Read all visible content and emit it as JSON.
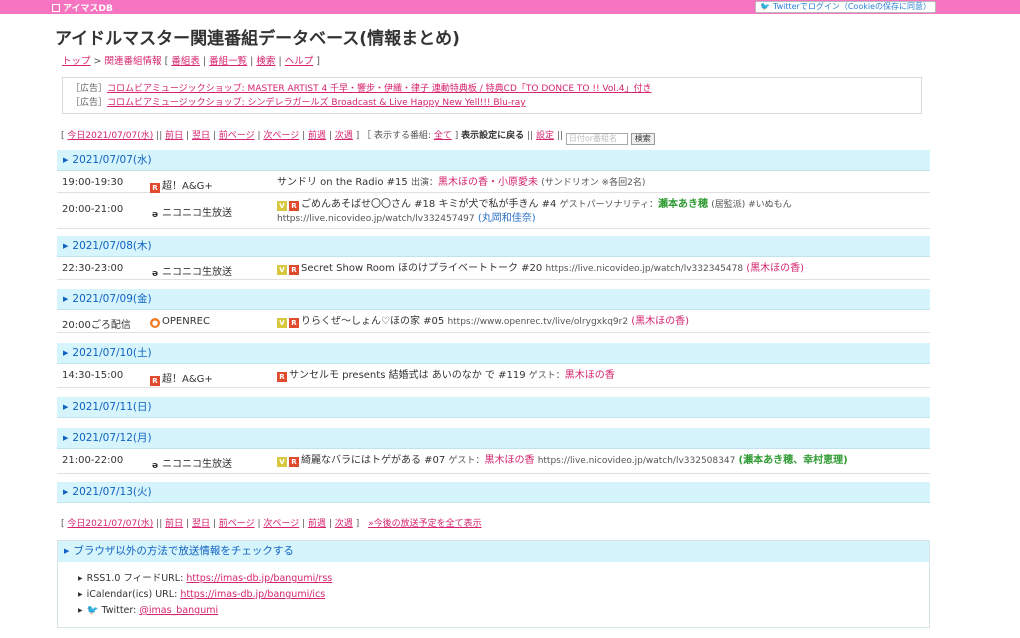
{
  "topbar": {
    "logo": "アイマスDB",
    "twitter_button": "Twitterでログイン（Cookieの保存に同意）"
  },
  "header": {
    "title": "アイドルマスター関連番組データベース(情報まとめ)"
  },
  "breadcrumb": {
    "top": "トップ",
    "sep": ">",
    "current": "関連番組情報",
    "open": "[",
    "close": "]",
    "bar": "|",
    "links": [
      "番組表",
      "番組一覧",
      "検索",
      "ヘルプ"
    ]
  },
  "ads": [
    {
      "tag": "［広告］",
      "text": "コロムビアミュージックショップ: MASTER ARTIST 4 千早・響步・伊織・律子 連動特典板 / 特典CD「TO DONCE TO !! Vol.4」付き"
    },
    {
      "tag": "［広告］",
      "text": "コロムビアミュージックショップ: シンデレラガールズ Broadcast & Live Happy New Yell!!! Blu-ray"
    }
  ],
  "nav": {
    "open": "[",
    "today": "今日2021/07/07(水)",
    "pipe": "||",
    "bar": "|",
    "prev_day": "前日",
    "next_day": "翌日",
    "prev_page": "前ページ",
    "next_page": "次ページ",
    "prev_week": "前週",
    "next_week": "次週",
    "close": "]",
    "filter_label": "［ 表示する番組:",
    "filter_all": "全て",
    "filter_close": "]",
    "display_settings": "表示設定に戻る",
    "settings": "設定",
    "search_placeholder": "日付or番組名",
    "search_button": "検索",
    "show_all": "»今後の放送予定を全て表示"
  },
  "days": [
    {
      "date": "2021/07/07(水)",
      "programs": [
        {
          "time": "19:00-19:30",
          "channel": "超！A&G+",
          "icons": [
            "r"
          ],
          "title": "サンドリ on the Radio #15",
          "cast_label": "出演：",
          "cast": "黒木ほの香・小原愛未",
          "note": "(サンドリオン ※各回2名)"
        },
        {
          "time": "20:00-21:00",
          "channel": "ニコニコ生放送",
          "icons": [
            "v",
            "r"
          ],
          "title": "ごめんあそばせ〇〇さん #18 キミが犬で私が手きん #4",
          "cast_label": "ゲストパーソナリティ：",
          "cast": "瀬本あき穂",
          "note": "(居監派) #いぬもん https://live.nicovideo.jp/watch/lv332457497",
          "extra": "(丸岡和佳奈)"
        }
      ]
    },
    {
      "date": "2021/07/08(木)",
      "programs": [
        {
          "time": "22:30-23:00",
          "channel": "ニコニコ生放送",
          "icons": [
            "v",
            "r"
          ],
          "title": "Secret Show Room ほのけプライベートトーク #20",
          "note": "https://live.nicovideo.jp/watch/lv332345478",
          "extra": "(黒木ほの香)"
        }
      ]
    },
    {
      "date": "2021/07/09(金)",
      "programs": [
        {
          "time": "20:00ごろ配信",
          "channel": "OPENREC",
          "icons": [
            "v",
            "r"
          ],
          "title": "りらくぜ〜しょん♡ほの家 #05",
          "note": "https://www.openrec.tv/live/olrygxkq9r2",
          "extra": "(黒木ほの香)"
        }
      ]
    },
    {
      "date": "2021/07/10(土)",
      "programs": [
        {
          "time": "14:30-15:00",
          "channel": "超！A&G+",
          "icons": [
            "r"
          ],
          "title": "サンセルモ presents 結婚式は あいのなか で #119",
          "cast_label": "ゲスト：",
          "cast": "黒木ほの香"
        }
      ]
    },
    {
      "date": "2021/07/11(日)",
      "programs": []
    },
    {
      "date": "2021/07/12(月)",
      "programs": [
        {
          "time": "21:00-22:00",
          "channel": "ニコニコ生放送",
          "icons": [
            "v",
            "r"
          ],
          "title": "綺麗なバラにはトゲがある #07",
          "cast_label": "ゲスト：",
          "cast": "黒木ほの香",
          "note": "https://live.nicovideo.jp/watch/lv332508347",
          "extra_green": "(瀬本あき穂、幸村恵理)"
        }
      ]
    },
    {
      "date": "2021/07/13(火)",
      "programs": []
    }
  ],
  "panel": {
    "title": "ブラウザ以外の方法で放送情報をチェックする",
    "rss_label": "RSS1.0 フィードURL:",
    "rss_url": "https://imas-db.jp/bangumi/rss",
    "ical_label": "iCalendar(ics) URL:",
    "ical_url": "https://imas-db.jp/bangumi/ics",
    "twitter_label": "Twitter:",
    "twitter_handle": "@imas_bangumi"
  }
}
